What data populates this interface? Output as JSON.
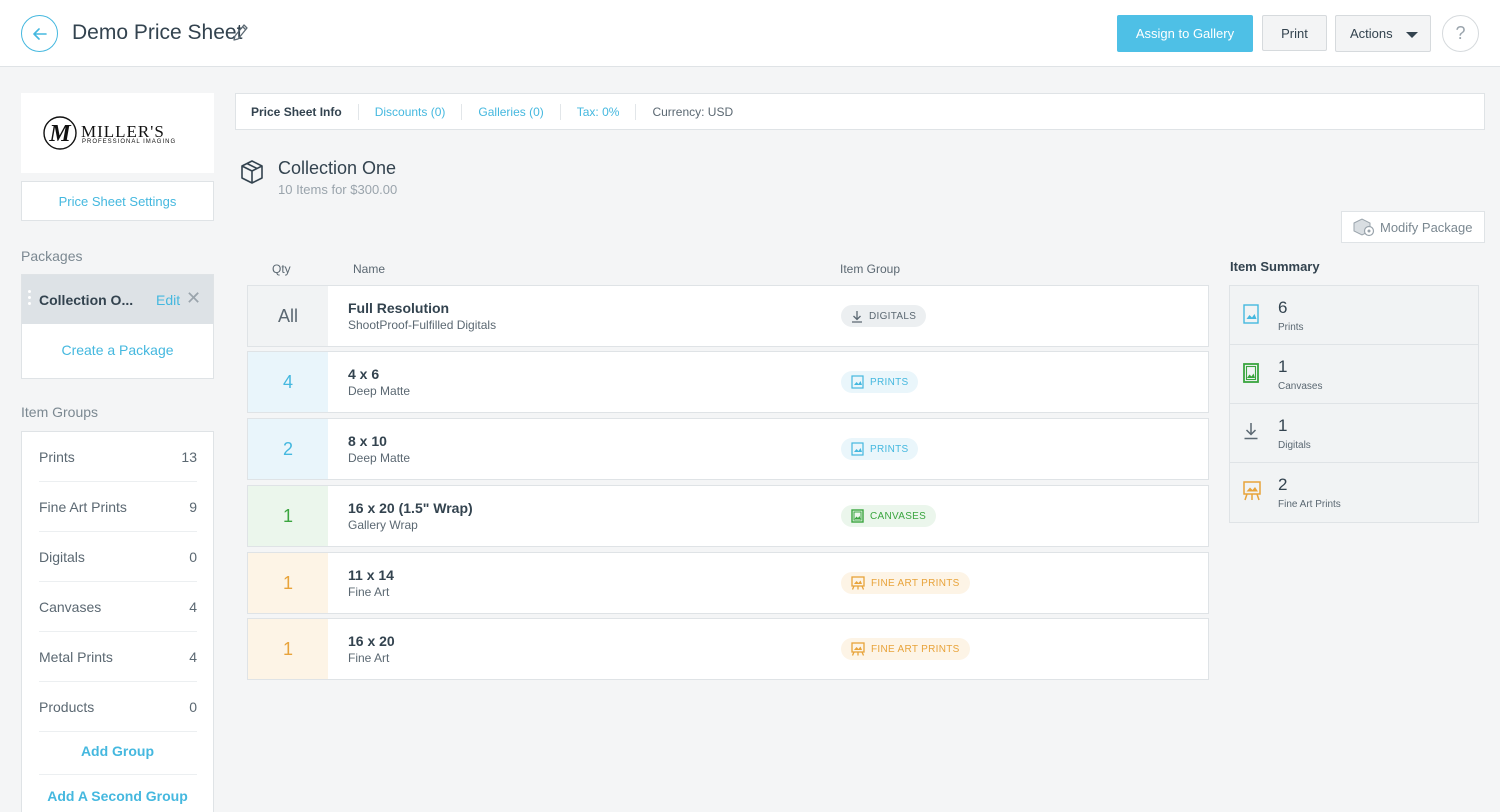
{
  "header": {
    "title": "Demo Price Sheet",
    "assign_label": "Assign to Gallery",
    "print_label": "Print",
    "actions_label": "Actions",
    "help_label": "?"
  },
  "sidebar": {
    "logo": {
      "name": "MILLER'S",
      "tagline": "PROFESSIONAL IMAGING"
    },
    "settings_label": "Price Sheet Settings",
    "packages_heading": "Packages",
    "active_package": {
      "name": "Collection O...",
      "edit_label": "Edit",
      "remove_label": "✕"
    },
    "create_package_label": "Create a Package",
    "item_groups_heading": "Item Groups",
    "item_groups": [
      {
        "label": "Prints",
        "count": "13"
      },
      {
        "label": "Fine Art Prints",
        "count": "9"
      },
      {
        "label": "Digitals",
        "count": "0"
      },
      {
        "label": "Canvases",
        "count": "4"
      },
      {
        "label": "Metal Prints",
        "count": "4"
      },
      {
        "label": "Products",
        "count": "0"
      }
    ],
    "add_group_label": "Add Group",
    "add_second_group_label": "Add A Second Group"
  },
  "tabs": [
    {
      "label": "Price Sheet Info"
    },
    {
      "label": "Discounts (0)"
    },
    {
      "label": "Galleries (0)"
    },
    {
      "label": "Tax: 0%"
    },
    {
      "label": "Currency: USD"
    }
  ],
  "collection": {
    "title": "Collection One",
    "subtitle": "10 Items for $300.00",
    "modify_label": "Modify Package"
  },
  "table": {
    "headers": {
      "qty": "Qty",
      "name": "Name",
      "group": "Item Group"
    },
    "rows": [
      {
        "qty": "All",
        "name": "Full Resolution",
        "sub": "ShootProof-Fulfilled Digitals",
        "group": "DIGITALS",
        "icon": "download-icon"
      },
      {
        "qty": "4",
        "name": "4 x 6",
        "sub": "Deep Matte",
        "group": "PRINTS",
        "icon": "print-icon"
      },
      {
        "qty": "2",
        "name": "8 x 10",
        "sub": "Deep Matte",
        "group": "PRINTS",
        "icon": "print-icon"
      },
      {
        "qty": "1",
        "name": "16 x 20 (1.5\" Wrap)",
        "sub": "Gallery Wrap",
        "group": "CANVASES",
        "icon": "canvas-icon"
      },
      {
        "qty": "1",
        "name": "11 x 14",
        "sub": "Fine Art",
        "group": "FINE ART PRINTS",
        "icon": "easel-icon"
      },
      {
        "qty": "1",
        "name": "16 x 20",
        "sub": "Fine Art",
        "group": "FINE ART PRINTS",
        "icon": "easel-icon"
      }
    ]
  },
  "summary": {
    "title": "Item Summary",
    "items": [
      {
        "count": "6",
        "label": "Prints",
        "icon": "print-icon"
      },
      {
        "count": "1",
        "label": "Canvases",
        "icon": "canvas-icon"
      },
      {
        "count": "1",
        "label": "Digitals",
        "icon": "download-icon"
      },
      {
        "count": "2",
        "label": "Fine Art Prints",
        "icon": "easel-icon"
      }
    ]
  },
  "colors": {
    "accent": "#4ec0e6",
    "prints": "#45b8df",
    "canvases": "#3aa53f",
    "fine_art": "#e8a33a",
    "digitals": "#5b6872"
  }
}
